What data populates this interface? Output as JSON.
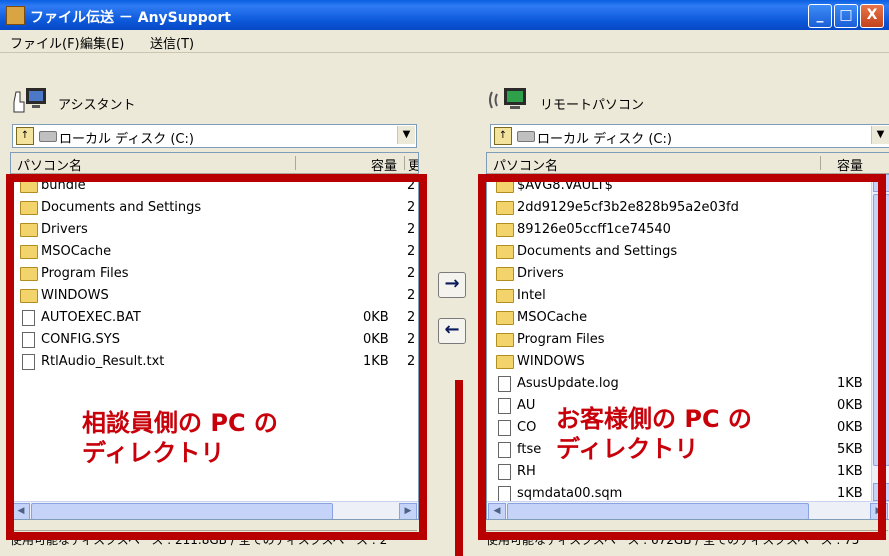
{
  "window": {
    "title": "ファイル伝送 － AnySupport",
    "buttons": {
      "minimize": "_",
      "maximize": "□",
      "close": "X"
    }
  },
  "menu": [
    "ファイル(F)",
    "編集(E)",
    "送信(T)"
  ],
  "left": {
    "label": "アシスタント",
    "drive": "ローカル ディスク (C:)",
    "columns": {
      "name": "パソコン名",
      "size": "容量",
      "date": "更"
    },
    "rows": [
      {
        "name": "bundle",
        "size": "",
        "date": "2",
        "type": "folder"
      },
      {
        "name": "Documents and Settings",
        "size": "",
        "date": "2",
        "type": "folder"
      },
      {
        "name": "Drivers",
        "size": "",
        "date": "2",
        "type": "folder"
      },
      {
        "name": "MSOCache",
        "size": "",
        "date": "2",
        "type": "folder"
      },
      {
        "name": "Program Files",
        "size": "",
        "date": "2",
        "type": "folder"
      },
      {
        "name": "WINDOWS",
        "size": "",
        "date": "2",
        "type": "folder"
      },
      {
        "name": "AUTOEXEC.BAT",
        "size": "0KB",
        "date": "2",
        "type": "file"
      },
      {
        "name": "CONFIG.SYS",
        "size": "0KB",
        "date": "2",
        "type": "file"
      },
      {
        "name": "RtlAudio_Result.txt",
        "size": "1KB",
        "date": "2",
        "type": "file"
      }
    ],
    "status": "使用可能なディスクスペース : 211.8GB / 全てのディスクスペース : 2"
  },
  "right": {
    "label": "リモートパソコン",
    "drive": "ローカル ディスク (C:)",
    "columns": {
      "name": "パソコン名",
      "size": "容量"
    },
    "rows": [
      {
        "name": "$AVG8.VAULT$",
        "size": "",
        "type": "folder"
      },
      {
        "name": "2dd9129e5cf3b2e828b95a2e03fd",
        "size": "",
        "type": "folder"
      },
      {
        "name": "89126e05ccff1ce74540",
        "size": "",
        "type": "folder"
      },
      {
        "name": "Documents and Settings",
        "size": "",
        "type": "folder"
      },
      {
        "name": "Drivers",
        "size": "",
        "type": "folder"
      },
      {
        "name": "Intel",
        "size": "",
        "type": "folder"
      },
      {
        "name": "MSOCache",
        "size": "",
        "type": "folder"
      },
      {
        "name": "Program Files",
        "size": "",
        "type": "folder"
      },
      {
        "name": "WINDOWS",
        "size": "",
        "type": "folder"
      },
      {
        "name": "AsusUpdate.log",
        "size": "1KB",
        "type": "file"
      },
      {
        "name": "AU",
        "size": "0KB",
        "type": "file"
      },
      {
        "name": "CO",
        "size": "0KB",
        "type": "file"
      },
      {
        "name": "ftse",
        "size": "5KB",
        "type": "file"
      },
      {
        "name": "RH",
        "size": "1KB",
        "type": "file"
      },
      {
        "name": "sqmdata00.sqm",
        "size": "1KB",
        "type": "file"
      }
    ],
    "status": "使用可能なディスクスペース : 672GB / 全てのディスクスペース : 75"
  },
  "transfer": {
    "send": "→",
    "receive": "←"
  },
  "annotations": {
    "left": "相談員側の PC の\nディレクトリ",
    "right": "お客様側の PC の\nディレクトリ"
  },
  "colors": {
    "annotation": "#b80000",
    "titlebar": "#0a5fe0"
  }
}
